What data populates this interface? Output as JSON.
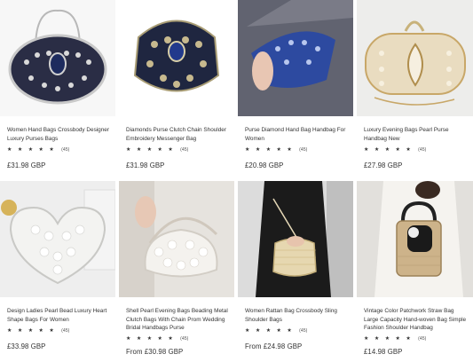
{
  "products": [
    {
      "title": "Women Hand Bags Crossbody Designer Luxury Purses Bags",
      "stars": "★ ★ ★ ★ ★",
      "reviews": "(45)",
      "price": "£31.98 GBP"
    },
    {
      "title": "Diamonds Purse Clutch Chain Shoulder Embroidery Messenger Bag",
      "stars": "★ ★ ★ ★ ★",
      "reviews": "(45)",
      "price": "£31.98 GBP"
    },
    {
      "title": "Purse Diamond Hand Bag Handbag For Women",
      "stars": "★ ★ ★ ★ ★",
      "reviews": "(45)",
      "price": "£20.98 GBP"
    },
    {
      "title": "Luxury Evening Bags Pearl Purse Handbag New",
      "stars": "★ ★ ★ ★ ★",
      "reviews": "(45)",
      "price": "£27.98 GBP"
    },
    {
      "title": "Design Ladies Pearl Bead Luxury Heart Shape Bags For Women",
      "stars": "★ ★ ★ ★ ★",
      "reviews": "(45)",
      "price": "£33.98 GBP"
    },
    {
      "title": "Shell Pearl Evening Bags Beading Metal Clutch Bags With Chain Prom Wedding Bridal Handbags Purse",
      "stars": "★ ★ ★ ★ ★",
      "reviews": "(45)",
      "price": "From £30.98 GBP"
    },
    {
      "title": "Women Rattan Bag Crossbody Sling Shoulder Bags",
      "stars": "★ ★ ★ ★ ★",
      "reviews": "(45)",
      "price": "From £24.98 GBP"
    },
    {
      "title": "Vintage Color Patchwork Straw Bag Large Capacity Hand-woven Bag Simple Fashion Shoulder Handbag",
      "stars": "★ ★ ★ ★ ★",
      "reviews": "(45)",
      "price": "£14.98 GBP"
    }
  ]
}
